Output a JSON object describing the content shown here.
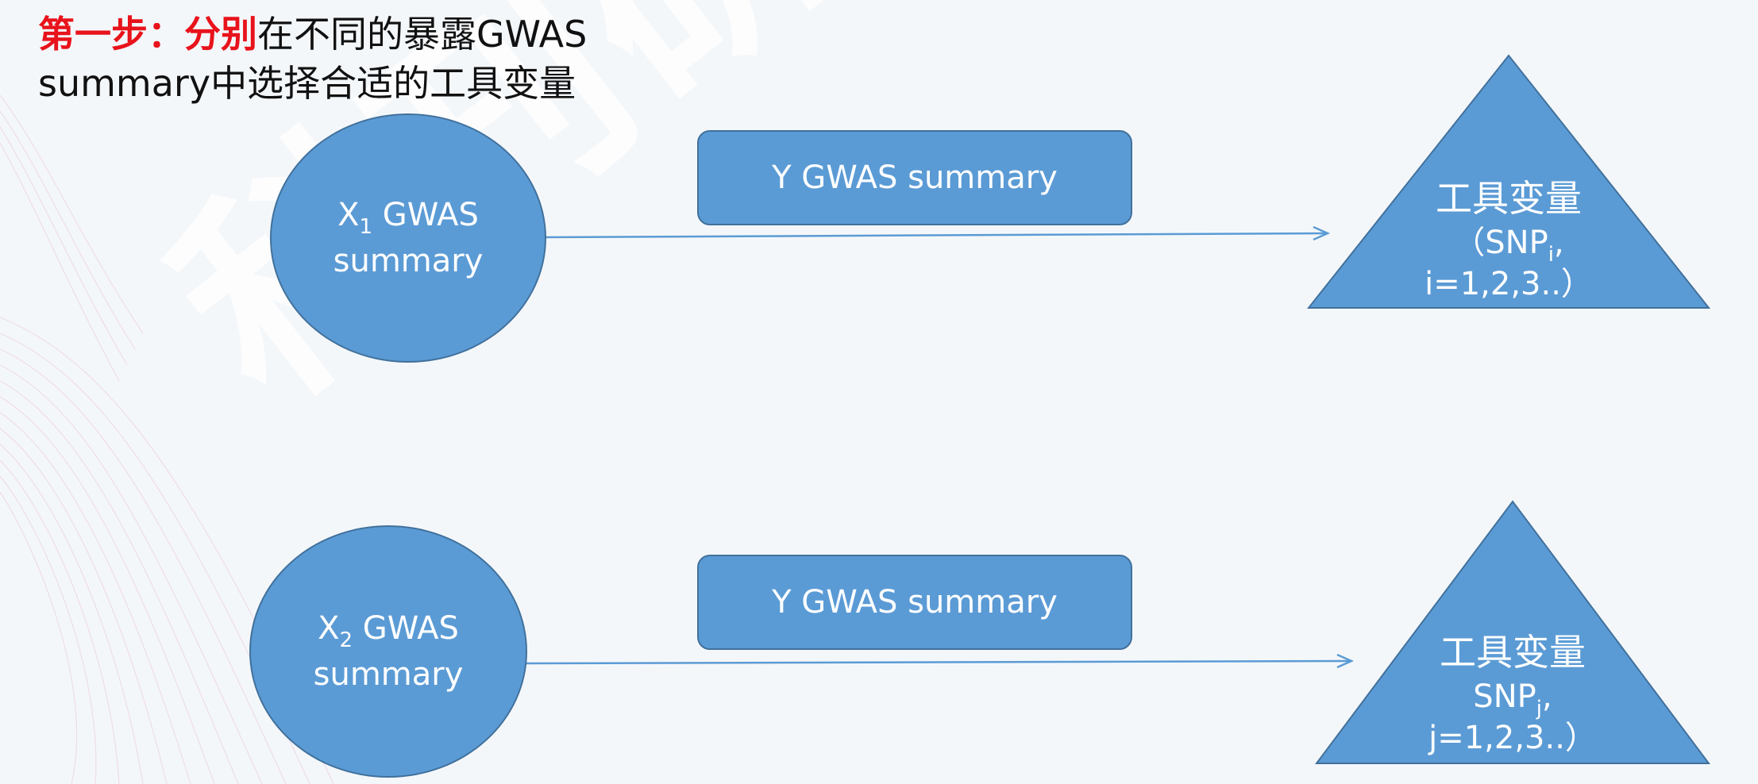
{
  "title": {
    "red_part": "第一步：分别",
    "line1_rest": "在不同的暴露GWAS",
    "line2": "summary中选择合适的工具变量"
  },
  "watermark": "科刊研习社",
  "rows": [
    {
      "exposure": {
        "prefix": "X",
        "sub": "1",
        "suffix": " GWAS",
        "line2": "summary"
      },
      "outcome_box": "Y GWAS summary",
      "instrument": {
        "title": "工具变量",
        "snp_prefix": "（SNP",
        "snp_sub": "i",
        "snp_suffix": ",",
        "index": "i=1,2,3..）"
      }
    },
    {
      "exposure": {
        "prefix": "X",
        "sub": "2",
        "suffix": " GWAS",
        "line2": "summary"
      },
      "outcome_box": "Y GWAS summary",
      "instrument": {
        "title": "工具变量",
        "snp_prefix": "SNP",
        "snp_sub": "j",
        "snp_suffix": ",",
        "index": "j=1,2,3..）"
      }
    }
  ],
  "colors": {
    "shape_fill": "#5b9bd5",
    "shape_border": "#41719c",
    "title_red": "#e8131b"
  }
}
